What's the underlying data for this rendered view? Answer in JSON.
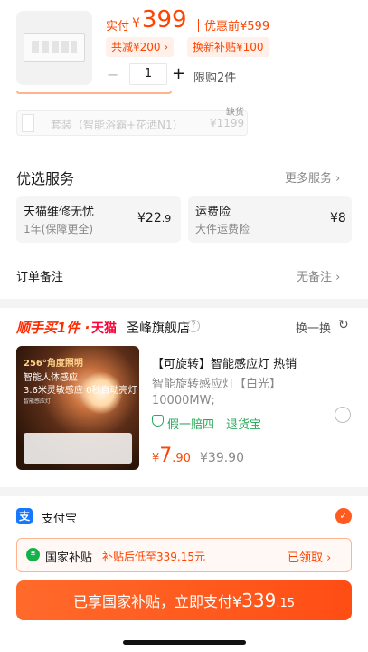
{
  "summary": {
    "pay_label": "实付",
    "currency": "¥",
    "pay_amount": "399",
    "orig_label": "优惠前¥599",
    "tag_discount": "共减¥200 ›",
    "tag_subsidy": "换新补贴¥100",
    "stepper_minus": "−",
    "quantity": "1",
    "stepper_plus": "+",
    "limit_text": "限购2件"
  },
  "bundle": {
    "name": "套装（智能浴霸+花洒N1）",
    "price": "¥1199",
    "stock_status": "缺货"
  },
  "services": {
    "title": "优选服务",
    "more": "更多服务 ›",
    "items": [
      {
        "title": "天猫维修无忧",
        "sub": "1年(保障更全)",
        "price_int": "¥22",
        "price_dec": ".9"
      },
      {
        "title": "运费险",
        "sub": "大件运费险",
        "price_int": "¥8",
        "price_dec": ""
      }
    ]
  },
  "order_note": {
    "label": "订单备注",
    "value": "无备注 ›"
  },
  "addon": {
    "brand": "顺手买1件 ·",
    "tmall": "天猫",
    "shop": "圣峰旗舰店",
    "help": "?",
    "swap": "换一换",
    "swap_icon": "↻",
    "image_text": {
      "l1": "256°角度照明",
      "l2": "智能人体感应",
      "l3": "3.6米灵敏感应  0秒自动亮灯",
      "l4": "智能感应灯"
    },
    "title": "【可旋转】智能感应灯 热销",
    "sub1": "智能旋转感应灯【白光】",
    "sub2": "10000MW;",
    "guarantee1": "假一赔四",
    "guarantee2": "退货宝",
    "price_currency": "¥",
    "price_int": "7",
    "price_dec": ".90",
    "orig_price": "¥39.90"
  },
  "payment": {
    "method_icon": "支",
    "method": "支付宝",
    "check": "✓",
    "subsidy_icon": "¥",
    "subsidy_name": "国家补贴",
    "subsidy_desc": "补贴后低至339.15元",
    "subsidy_status": "已领取 ›",
    "pay_button_prefix": "已享国家补贴，立即支付",
    "pay_button_currency": "¥",
    "pay_button_amount": "339",
    "pay_button_decimal": ".15"
  },
  "colors": {
    "accent": "#ff4400",
    "alipay_blue": "#1677ff",
    "subsidy_green": "#14b14a",
    "guarantee_green": "#2aaa5a"
  }
}
